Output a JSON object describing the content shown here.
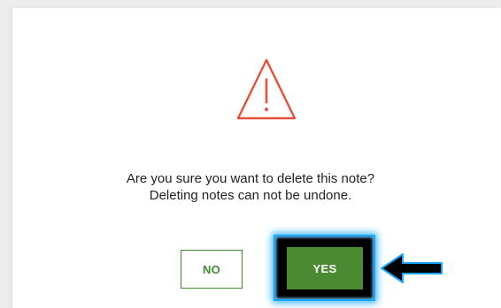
{
  "dialog": {
    "icon": "warning-triangle-icon",
    "message_line1": "Are you sure you want to delete this note?",
    "message_line2": "Deleting notes can not be undone.",
    "no_label": "NO",
    "yes_label": "YES"
  },
  "colors": {
    "warning": "#e4513b",
    "primary_green": "#4a8a33",
    "outline_green": "#3e8a2e",
    "highlight_blue": "#1aa3ff"
  },
  "annotation": {
    "arrow_icon": "left-arrow-icon"
  }
}
